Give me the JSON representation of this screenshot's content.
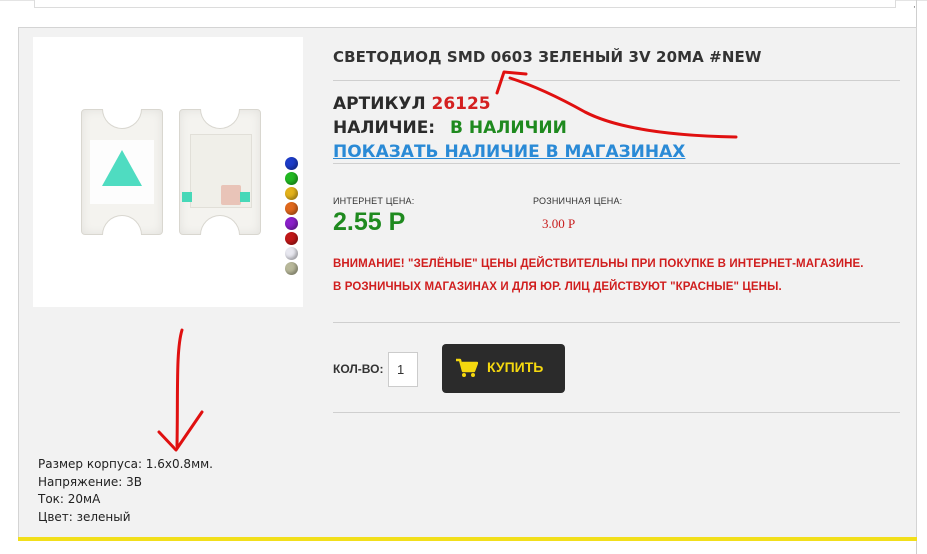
{
  "product": {
    "title": "СВЕТОДИОД SMD 0603 ЗЕЛЕНЫЙ 3V 20MA #NEW",
    "sku_label": "АРТИКУЛ",
    "sku_value": "26125",
    "stock_label": "НАЛИЧИЕ:",
    "stock_value": "В НАЛИЧИИ",
    "stores_link": "ПОКАЗАТЬ НАЛИЧИЕ В МАГАЗИНАХ"
  },
  "pricing": {
    "online_label": "ИНТЕРНЕТ ЦЕНА:",
    "online_price": "2.55 Р",
    "retail_label": "РОЗНИЧНАЯ ЦЕНА:",
    "retail_price": "3.00 Р",
    "notice_line1": "ВНИМАНИЕ! \"ЗЕЛЁНЫЕ\" ЦЕНЫ ДЕЙСТВИТЕЛЬНЫ ПРИ ПОКУПКЕ В ИНТЕРНЕТ-МАГАЗИНЕ.",
    "notice_line2": "В РОЗНИЧНЫХ МАГАЗИНАХ И ДЛЯ ЮР. ЛИЦ ДЕЙСТВУЮТ \"КРАСНЫЕ\" ЦЕНЫ."
  },
  "cart": {
    "qty_label": "КОЛ-ВО:",
    "qty_value": "1",
    "buy_label": "КУПИТЬ"
  },
  "specs": [
    "Размер корпуса: 1.6x0.8мм.",
    "Напряжение: 3В",
    "Ток: 20мА",
    "Цвет: зеленый"
  ],
  "colors": {
    "price_green": "#1f8a1f",
    "price_red": "#d42020",
    "link_blue": "#2a8ad6",
    "button_bg": "#2b2b2b",
    "button_text": "#f5d80f",
    "accent_yellow": "#f2df1a",
    "annotation_red": "#e01010"
  },
  "image_swatches": [
    "#1d3cc8",
    "#22b822",
    "#e3b21b",
    "#e0681c",
    "#8a1fc9",
    "#c01818",
    "#e8e8f0",
    "#b8b89a"
  ],
  "icons": {
    "cart": "shopping-cart-icon"
  }
}
